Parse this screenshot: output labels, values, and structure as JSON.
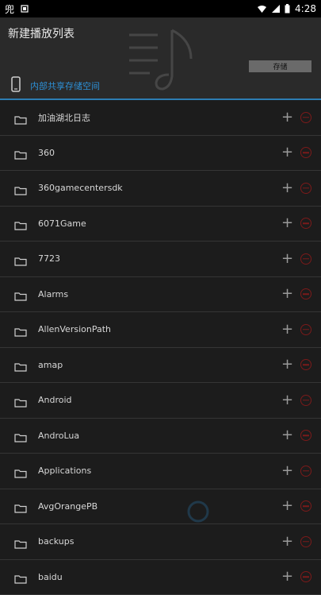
{
  "status": {
    "app_badge": "兜",
    "time": "4:28"
  },
  "header": {
    "title": "新建播放列表",
    "save_label": "存储",
    "storage_label": "内部共享存储空间"
  },
  "folders": [
    "加油湖北日志",
    "360",
    "360gamecentersdk",
    "6071Game",
    "7723",
    "Alarms",
    "AllenVersionPath",
    "amap",
    "Android",
    "AndroLua",
    "Applications",
    "AvgOrangePB",
    "backups",
    "baidu"
  ],
  "colors": {
    "accent": "#2d8fd5",
    "remove": "#7b1a1a",
    "background": "#1c1c1c"
  },
  "icons": {
    "folder": "folder-icon",
    "add": "plus-icon",
    "remove": "minus-circle-icon",
    "phone": "phone-icon",
    "music": "music-note-icon"
  }
}
